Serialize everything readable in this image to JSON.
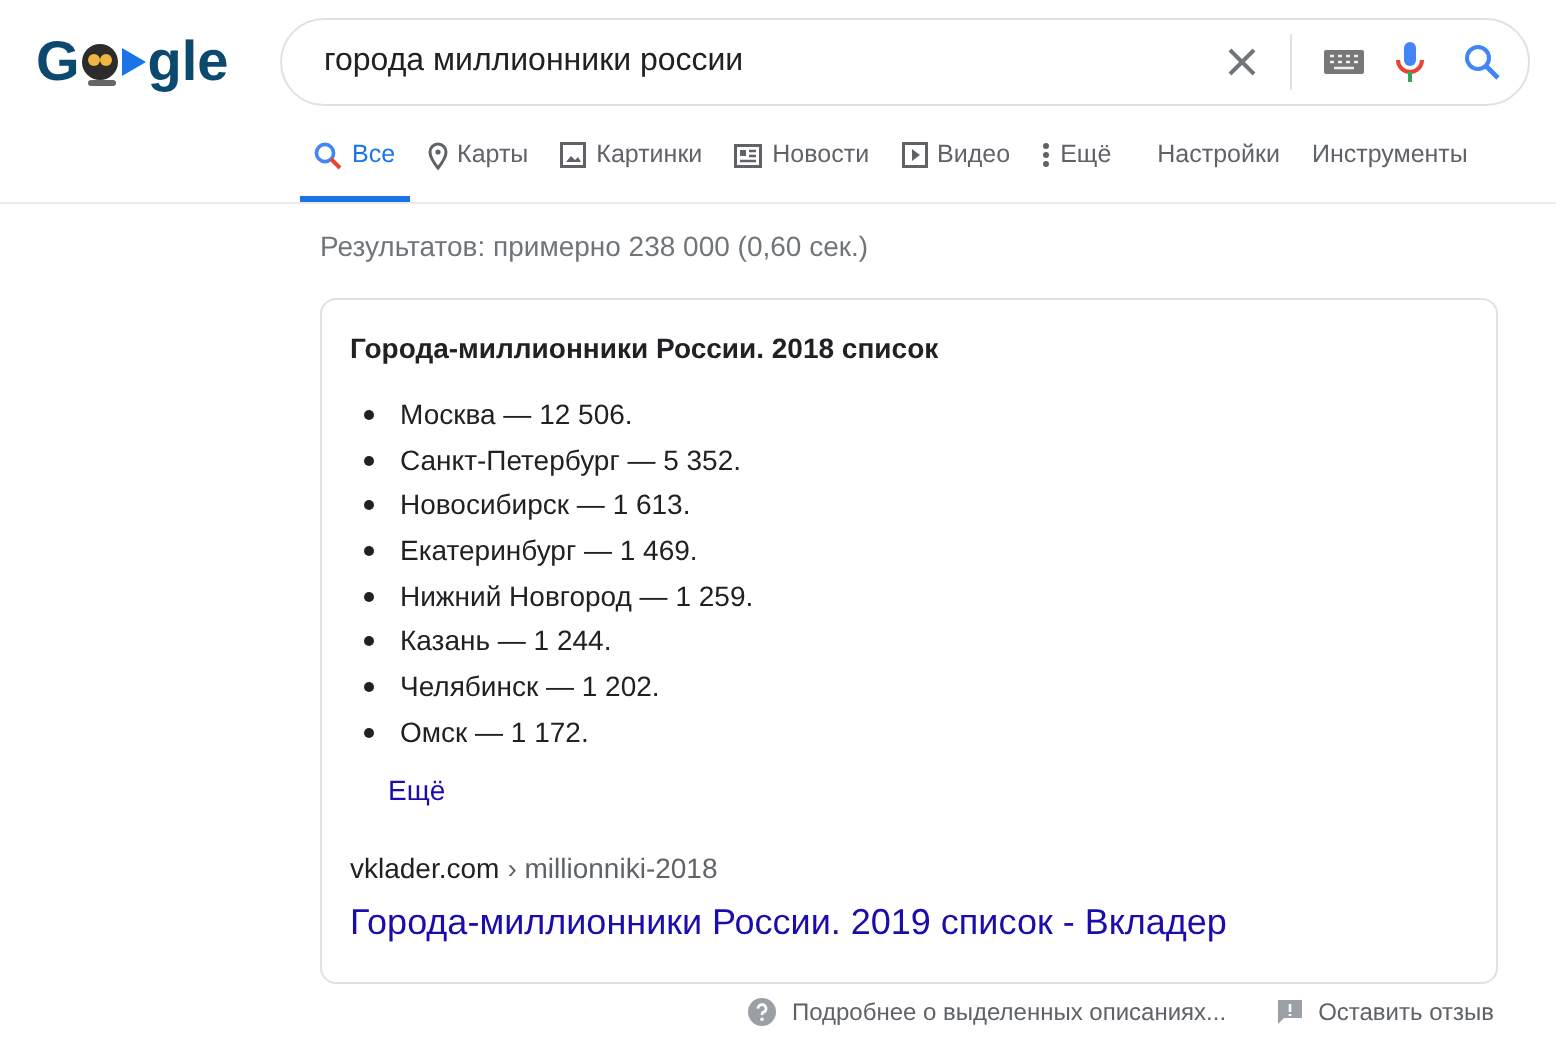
{
  "logo": {
    "before": "G",
    "after": "gle"
  },
  "search": {
    "value": "города миллионники россии"
  },
  "tabs": [
    {
      "label": "Все",
      "kind": "search",
      "selected": true
    },
    {
      "label": "Карты",
      "kind": "maps",
      "selected": false
    },
    {
      "label": "Картинки",
      "kind": "images",
      "selected": false
    },
    {
      "label": "Новости",
      "kind": "news",
      "selected": false
    },
    {
      "label": "Видео",
      "kind": "video",
      "selected": false
    },
    {
      "label": "Ещё",
      "kind": "more",
      "selected": false
    }
  ],
  "tools": [
    "Настройки",
    "Инструменты"
  ],
  "result_stats": "Результатов: примерно 238 000 (0,60 сек.)",
  "snippet": {
    "title": "Города-миллионники России. 2018 список",
    "items": [
      "Москва — 12 506.",
      "Санкт-Петербург — 5 352.",
      "Новосибирск — 1 613.",
      "Екатеринбург — 1 469.",
      "Нижний Новгород — 1 259.",
      "Казань — 1 244.",
      "Челябинск — 1 202.",
      "Омск — 1 172."
    ],
    "more": "Ещё",
    "site": "vklader.com",
    "path": "› millionniki-2018",
    "link": "Города-миллионники России. 2019 список - Вкладер"
  },
  "footer": {
    "about": "Подробнее о выделенных описаниях...",
    "feedback": "Оставить отзыв"
  }
}
